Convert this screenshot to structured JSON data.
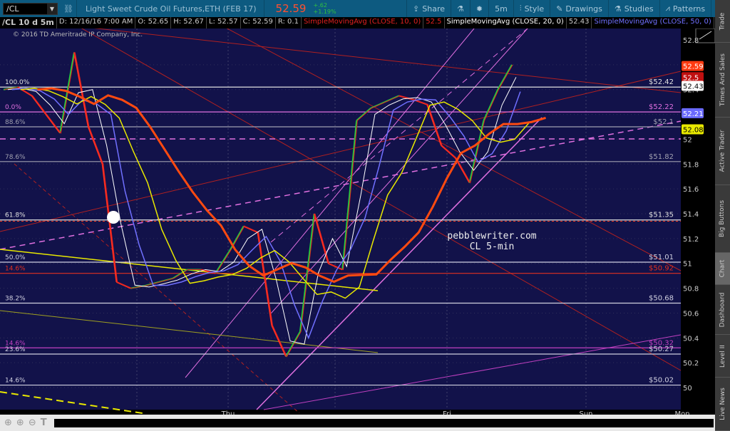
{
  "header": {
    "symbol": "/CL",
    "title": "Light Sweet Crude Oil Futures,ETH (FEB 17)",
    "last": "52.59",
    "change": "+.62",
    "change_pct": "+1.19%",
    "toolbar": [
      {
        "icon": "share-icon",
        "label": "Share"
      },
      {
        "icon": "flask-icon",
        "label": ""
      },
      {
        "icon": "gear-icon",
        "label": ""
      },
      {
        "icon": "",
        "label": "5m"
      },
      {
        "icon": "candle-icon",
        "label": "Style"
      },
      {
        "icon": "pencil-icon",
        "label": "Drawings"
      },
      {
        "icon": "flask-icon",
        "label": "Studies"
      },
      {
        "icon": "pattern-icon",
        "label": "Patterns"
      },
      {
        "icon": "menu-icon",
        "label": ""
      }
    ]
  },
  "info": {
    "symbol": "/CL 10 d 5m",
    "d": "D: 12/16/16 7:00 AM",
    "o": "O: 52.65",
    "h": "H: 52.67",
    "l": "L: 52.57",
    "c": "C: 52.59",
    "r": "R: 0.1",
    "studies": [
      {
        "label": "SimpleMovingAvg (CLOSE, 10, 0)",
        "value": "52.5",
        "color": "#e02020"
      },
      {
        "label": "SimpleMovingAvg (CLOSE, 20, 0)",
        "value": "52.43",
        "color": "#ffffff"
      },
      {
        "label": "SimpleMovingAvg (CLOSE, 50, 0)",
        "value": "52.21",
        "color": "#7070ff"
      },
      {
        "label": "SimpleMoving...",
        "value": "",
        "color": "#e8e800"
      }
    ]
  },
  "copyright": "© 2016 TD Ameritrade IP Company, Inc.",
  "watermark": [
    "pebblewriter.com",
    "CL 5-min"
  ],
  "sidebar": [
    "Trade",
    "Times And Sales",
    "Active Trader",
    "Big Buttons",
    "Chart",
    "Dashboard",
    "Level II",
    "Live News"
  ],
  "sidebar_active": "Chart",
  "chart_data": {
    "type": "line",
    "ylim": [
      49.8,
      52.95
    ],
    "y_ticks": [
      "52.8",
      "52.4",
      "52",
      "51.8",
      "51.6",
      "51.4",
      "51.2",
      "51",
      "50.8",
      "50.6",
      "50.4",
      "50.2",
      "50"
    ],
    "x_labels": [
      "Thu",
      "Fri",
      "Sun",
      "Mon"
    ],
    "price": [
      52.4,
      52.42,
      52.35,
      52.2,
      52.05,
      52.7,
      52.1,
      51.8,
      50.85,
      50.8,
      50.82,
      50.85,
      50.88,
      50.95,
      50.95,
      50.92,
      51.1,
      51.3,
      51.25,
      50.5,
      50.25,
      50.45,
      51.4,
      51.0,
      50.95,
      52.15,
      52.25,
      52.3,
      52.35,
      52.32,
      52.28,
      51.95,
      51.85,
      51.65,
      52.15,
      52.4,
      52.6
    ],
    "levels": [
      {
        "pct": "100.0%",
        "price": 52.42,
        "label": "$52.42",
        "color": "#e0e0e0"
      },
      {
        "pct": "0.0%",
        "price": 52.22,
        "label": "$52.22",
        "color": "#e070e0"
      },
      {
        "pct": "88.6%",
        "price": 52.1,
        "label": "$52.1",
        "color": "#a0a0b0"
      },
      {
        "pct": "78.6%",
        "price": 51.82,
        "label": "$51.82",
        "color": "#a0a0b0"
      },
      {
        "pct": "61.8%",
        "price": 51.35,
        "label": "$51.35",
        "color": "#e0e0e0"
      },
      {
        "pct": "50.0%",
        "price": 51.01,
        "label": "$51.01",
        "color": "#d0d0e0"
      },
      {
        "pct": "14.6%",
        "price": 50.92,
        "label": "$50.92",
        "color": "#e03020"
      },
      {
        "pct": "38.2%",
        "price": 50.68,
        "label": "$50.68",
        "color": "#d0d0e0"
      },
      {
        "pct": "14.6%",
        "price": 50.32,
        "label": "$50.32",
        "color": "#c040c0"
      },
      {
        "pct": "23.6%",
        "price": 50.27,
        "label": "$50.27",
        "color": "#d0d0e0"
      },
      {
        "pct": "14.6%",
        "price": 50.02,
        "label": "$50.02",
        "color": "#d0d0e0"
      }
    ],
    "badges": [
      {
        "value": "52.59",
        "color": "#ff3a10",
        "text": "#fff"
      },
      {
        "value": "52.5",
        "color": "#c01010",
        "text": "#fff"
      },
      {
        "value": "52.43",
        "color": "#ffffff",
        "text": "#000"
      },
      {
        "value": "52.21",
        "color": "#6a6aff",
        "text": "#fff"
      },
      {
        "value": "52.08",
        "color": "#e8e800",
        "text": "#000"
      }
    ],
    "series": [
      {
        "name": "SimpleMovingAvg (CLOSE, 10, 0)",
        "color": "#e02020"
      },
      {
        "name": "SimpleMovingAvg (CLOSE, 20, 0)",
        "color": "#ffffff"
      },
      {
        "name": "SimpleMovingAvg (CLOSE, 50, 0)",
        "color": "#7070ff"
      },
      {
        "name": "SimpleMoving...",
        "color": "#e8e800"
      }
    ]
  }
}
